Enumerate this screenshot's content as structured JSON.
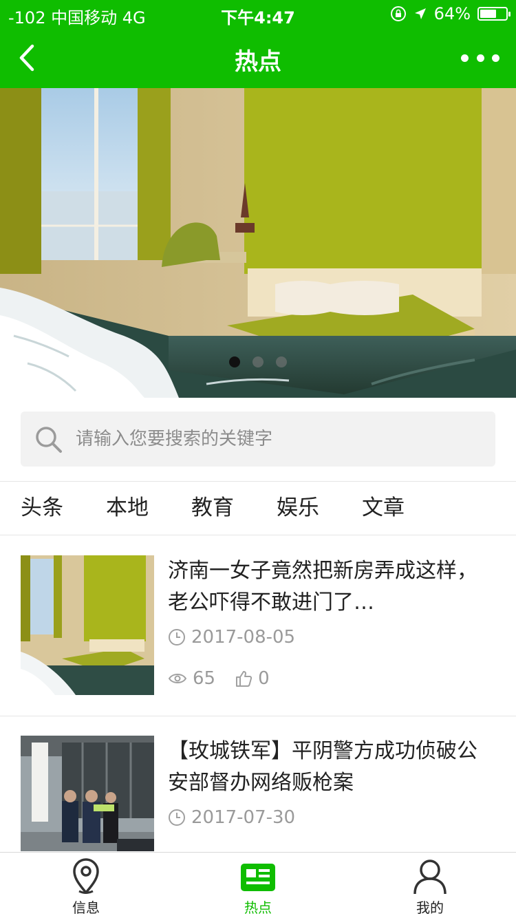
{
  "status_bar": {
    "carrier": "-102 中国移动   4G",
    "time": "下午4:47",
    "battery_text": "64%",
    "battery_level": 0.64
  },
  "navbar": {
    "title": "热点",
    "back_icon": "chevron-left-icon",
    "more_icon": "more-dots-icon"
  },
  "banner": {
    "slide_count": 3,
    "active_slide": 1
  },
  "search": {
    "placeholder": "请输入您要搜索的关键字",
    "value": ""
  },
  "tabs": [
    {
      "label": "头条"
    },
    {
      "label": "本地"
    },
    {
      "label": "教育"
    },
    {
      "label": "娱乐"
    },
    {
      "label": "文章"
    }
  ],
  "articles": [
    {
      "title": "济南一女子竟然把新房弄成这样，老公吓得不敢进门了…",
      "date": "2017-08-05",
      "views": "65",
      "likes": "0"
    },
    {
      "title": "【玫城铁军】平阴警方成功侦破公安部督办网络贩枪案",
      "date": "2017-07-30"
    }
  ],
  "tabbar": [
    {
      "label": "信息",
      "icon": "location-pin-icon",
      "active": false
    },
    {
      "label": "热点",
      "icon": "news-icon",
      "active": true
    },
    {
      "label": "我的",
      "icon": "user-icon",
      "active": false
    }
  ],
  "colors": {
    "brand_green": "#0fbd00",
    "meta_gray": "#9a9a9a"
  }
}
